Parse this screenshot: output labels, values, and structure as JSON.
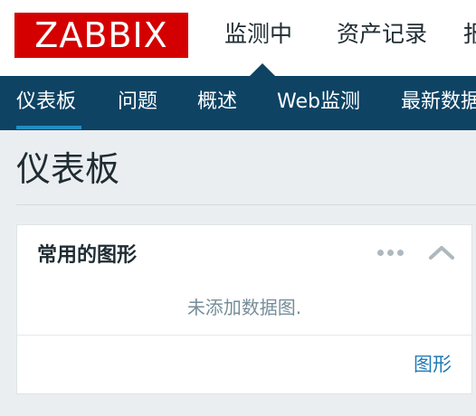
{
  "header": {
    "logo_text": "ZABBIX",
    "main_nav": [
      "监测中",
      "资产记录",
      "报"
    ]
  },
  "sub_nav": {
    "items": [
      "仪表板",
      "问题",
      "概述",
      "Web监测",
      "最新数据"
    ],
    "active": "仪表板"
  },
  "page": {
    "title": "仪表板"
  },
  "widget": {
    "title": "常用的图形",
    "empty_message": "未添加数据图.",
    "footer_link": "图形",
    "more_icon": "ellipsis-icon",
    "collapse_icon": "chevron-up-icon"
  },
  "colors": {
    "logo_bg": "#d40000",
    "subnav_bg": "#0e4364",
    "active_indicator": "#1f8ec2",
    "link": "#1f7ab8"
  }
}
